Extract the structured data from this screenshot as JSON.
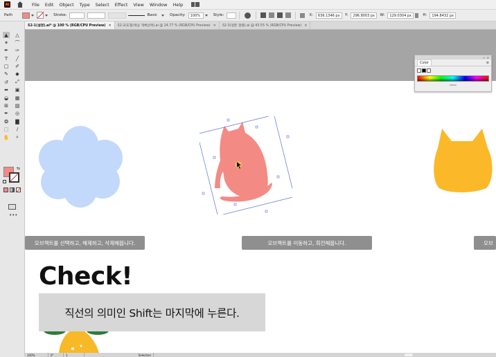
{
  "app": {
    "logo_text": "Ai"
  },
  "menu": {
    "items": [
      "File",
      "Edit",
      "Object",
      "Type",
      "Select",
      "Effect",
      "View",
      "Window",
      "Help"
    ]
  },
  "control_bar": {
    "selection_label": "Path",
    "fill_color": "#f48a84",
    "stroke_label": "Stroke:",
    "brush_label": "Basic",
    "opacity_label": "Opacity:",
    "opacity_value": "100%",
    "style_label": "Style:",
    "x_label": "X:",
    "x_value": "636.1346 px",
    "y_label": "Y:",
    "y_value": "296.8003 px",
    "w_label": "W:",
    "w_value": "129.0304 px",
    "h_label": "H:",
    "h_value": "194.8432 px"
  },
  "tabs": [
    {
      "label": "S2-1(설명).ai* @ 100 % (RGB/CPU Preview)",
      "active": true
    },
    {
      "label": "S2-2(도형)색상 개체선택).ai @ 24.77 % (RGB/CPU Preview)",
      "active": false
    },
    {
      "label": "S2-3(정돈 정렬).ai @ 43.55 % (RGB/CPU Preview)",
      "active": false
    }
  ],
  "tab_close_glyph": "×",
  "toolbar": {
    "tools": [
      "selection-tool",
      "direct-selection-tool",
      "magic-wand-tool",
      "lasso-tool",
      "pen-tool",
      "curvature-tool",
      "type-tool",
      "line-tool",
      "rectangle-tool",
      "paintbrush-tool",
      "shaper-tool",
      "eraser-tool",
      "rotate-tool",
      "scale-tool",
      "width-tool",
      "free-transform-tool",
      "shape-builder-tool",
      "perspective-grid-tool",
      "mesh-tool",
      "gradient-tool",
      "eyedropper-tool",
      "blend-tool",
      "symbol-sprayer-tool",
      "column-graph-tool",
      "artboard-tool",
      "slice-tool",
      "hand-tool",
      "zoom-tool"
    ],
    "fill_color": "#f48a84",
    "more_label": "•••"
  },
  "artboard": {
    "caption_left": "오브젝트를 선택하고, 해제하고, 삭제해봅니다.",
    "caption_center": "오브젝트를 이동하고, 회전해봅니다.",
    "caption_right": "오브",
    "check_title": "Check!",
    "tip_text": "직선의 의미인 Shift는 마지막에 누른다.",
    "flower_color": "#c3d9fb",
    "cat_color": "#f48a84",
    "cat_right_color": "#fbb829",
    "bottom_fruit_color": "#f7b928"
  },
  "color_panel": {
    "title": "Color",
    "menu_glyph": "≡",
    "collapse_glyph": "«",
    "close_glyph": "×"
  },
  "status_bar": {
    "zoom": "100%",
    "rotate": "0°",
    "artboard": "1",
    "tool": "Selection"
  }
}
